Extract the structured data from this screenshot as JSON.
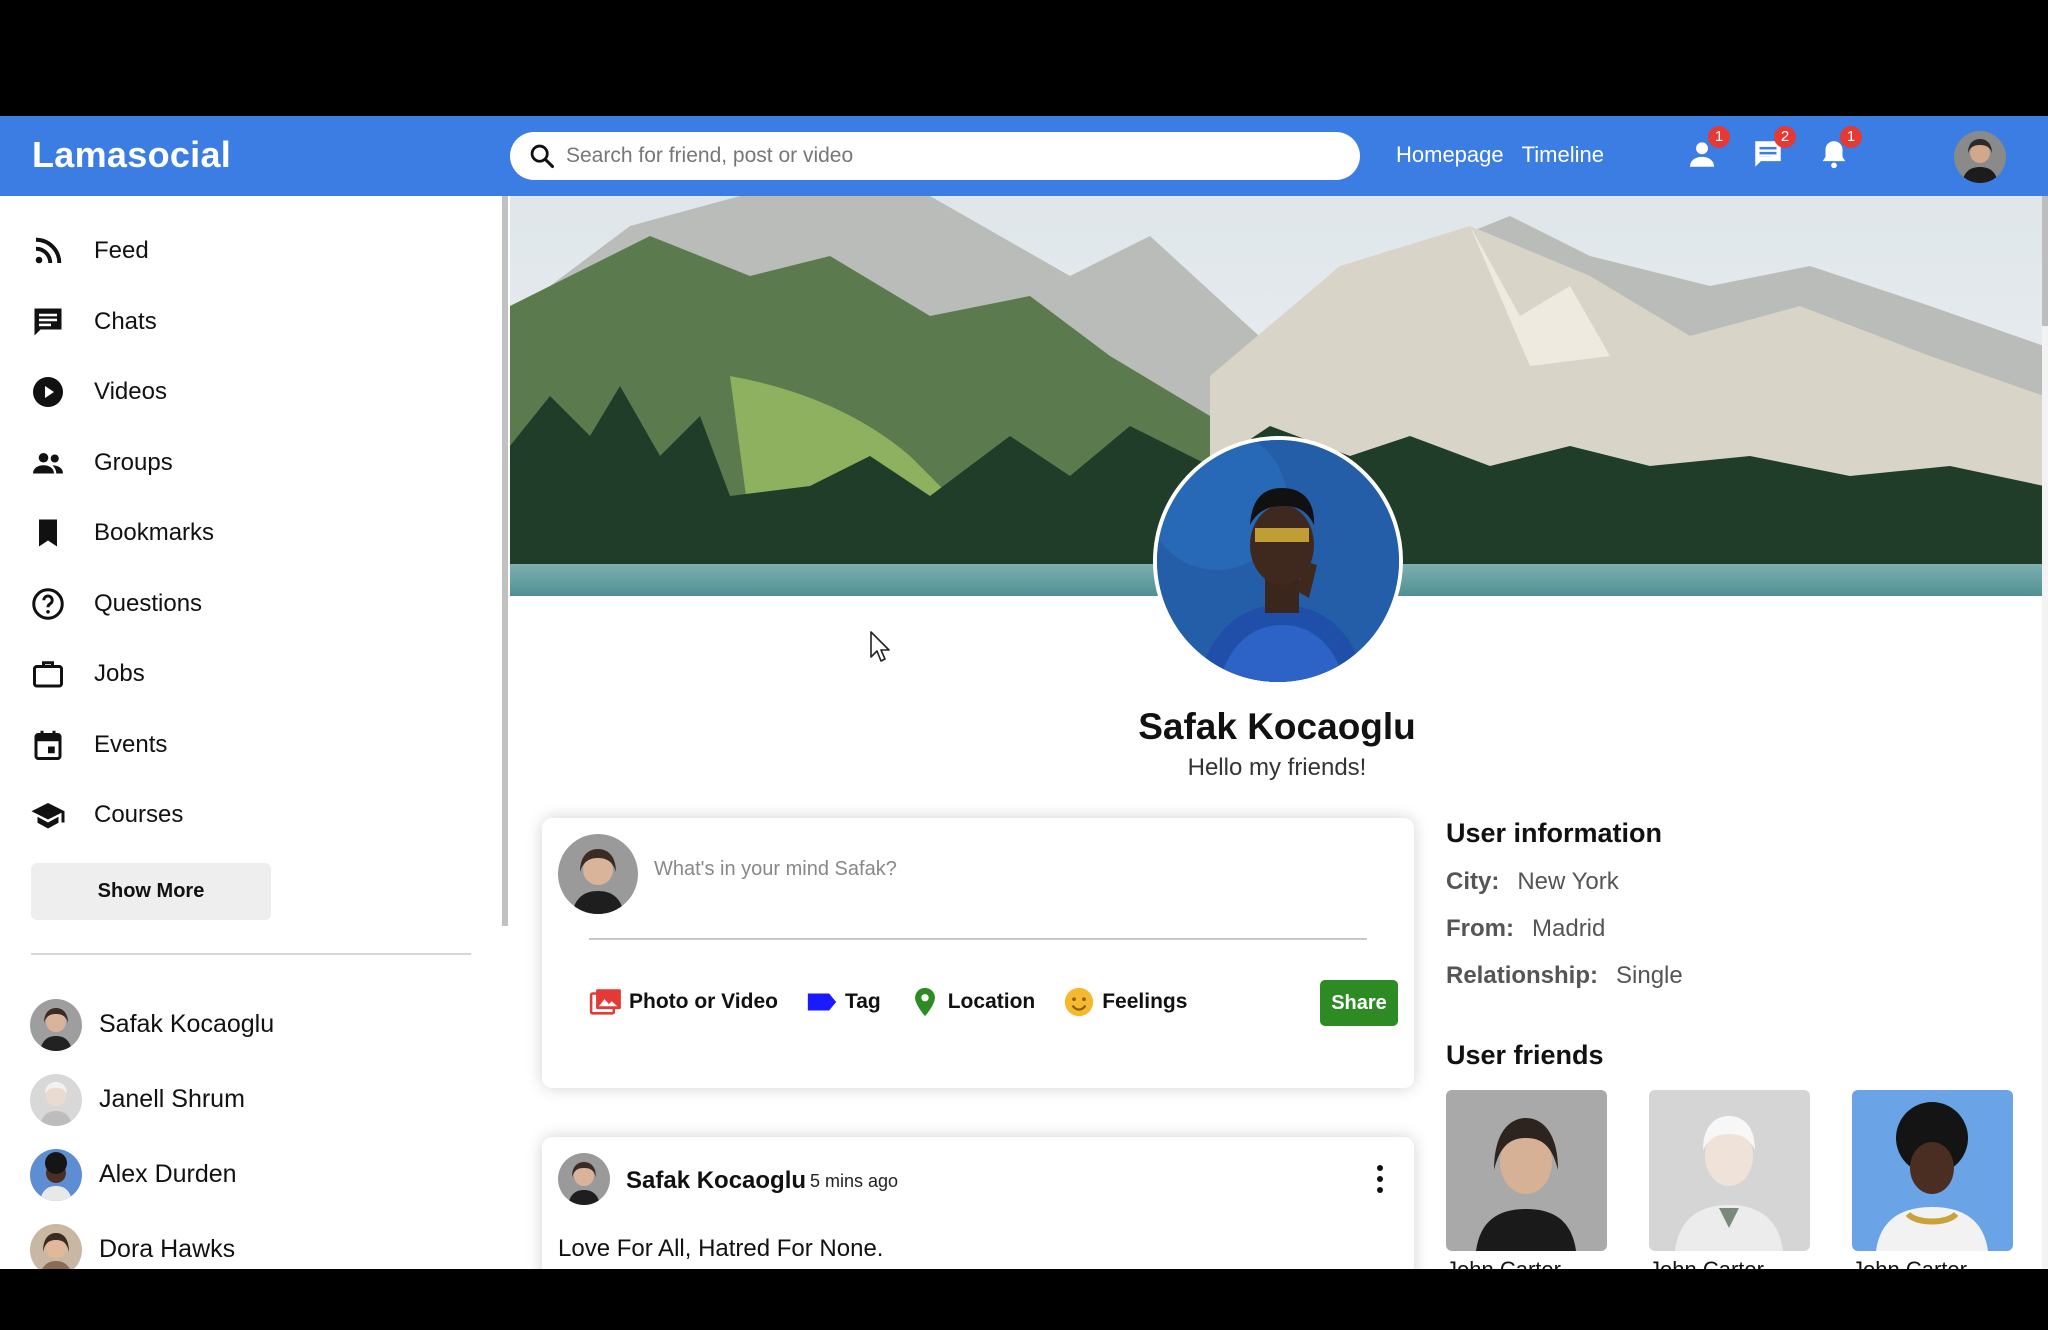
{
  "topbar": {
    "logo": "Lamasocial",
    "search_placeholder": "Search for friend, post or video",
    "links": [
      "Homepage",
      "Timeline"
    ],
    "badges": {
      "friend_requests": "1",
      "messages": "2",
      "notifications": "1"
    },
    "brand_color": "#3b7de3"
  },
  "sidebar": {
    "menu": [
      {
        "label": "Feed",
        "icon": "rss-feed-icon"
      },
      {
        "label": "Chats",
        "icon": "chat-icon"
      },
      {
        "label": "Videos",
        "icon": "play-circle-icon"
      },
      {
        "label": "Groups",
        "icon": "group-icon"
      },
      {
        "label": "Bookmarks",
        "icon": "bookmark-icon"
      },
      {
        "label": "Questions",
        "icon": "help-outline-icon"
      },
      {
        "label": "Jobs",
        "icon": "work-outline-icon"
      },
      {
        "label": "Events",
        "icon": "event-icon"
      },
      {
        "label": "Courses",
        "icon": "school-icon"
      }
    ],
    "show_more": "Show More",
    "friends": [
      "Safak Kocaoglu",
      "Janell Shrum",
      "Alex Durden",
      "Dora Hawks"
    ]
  },
  "profile": {
    "name": "Safak Kocaoglu",
    "desc": "Hello my friends!"
  },
  "share": {
    "placeholder": "What's in your mind Safak?",
    "options": [
      {
        "label": "Photo or Video",
        "icon": "perm-media-icon",
        "color": "#e53935"
      },
      {
        "label": "Tag",
        "icon": "label-icon",
        "color": "#1a1aff"
      },
      {
        "label": "Location",
        "icon": "room-icon",
        "color": "#2e8b24"
      },
      {
        "label": "Feelings",
        "icon": "emoji-icon",
        "color": "#f5b82e"
      }
    ],
    "button": "Share"
  },
  "post": {
    "username": "Safak Kocaoglu",
    "date": "5 mins ago",
    "text": "Love For All, Hatred For None."
  },
  "user_info": {
    "title": "User information",
    "rows": [
      {
        "key": "City:",
        "value": "New York"
      },
      {
        "key": "From:",
        "value": "Madrid"
      },
      {
        "key": "Relationship:",
        "value": "Single"
      }
    ],
    "friends_title": "User friends",
    "friends": [
      "John Carter",
      "John Carter",
      "John Carter"
    ]
  }
}
